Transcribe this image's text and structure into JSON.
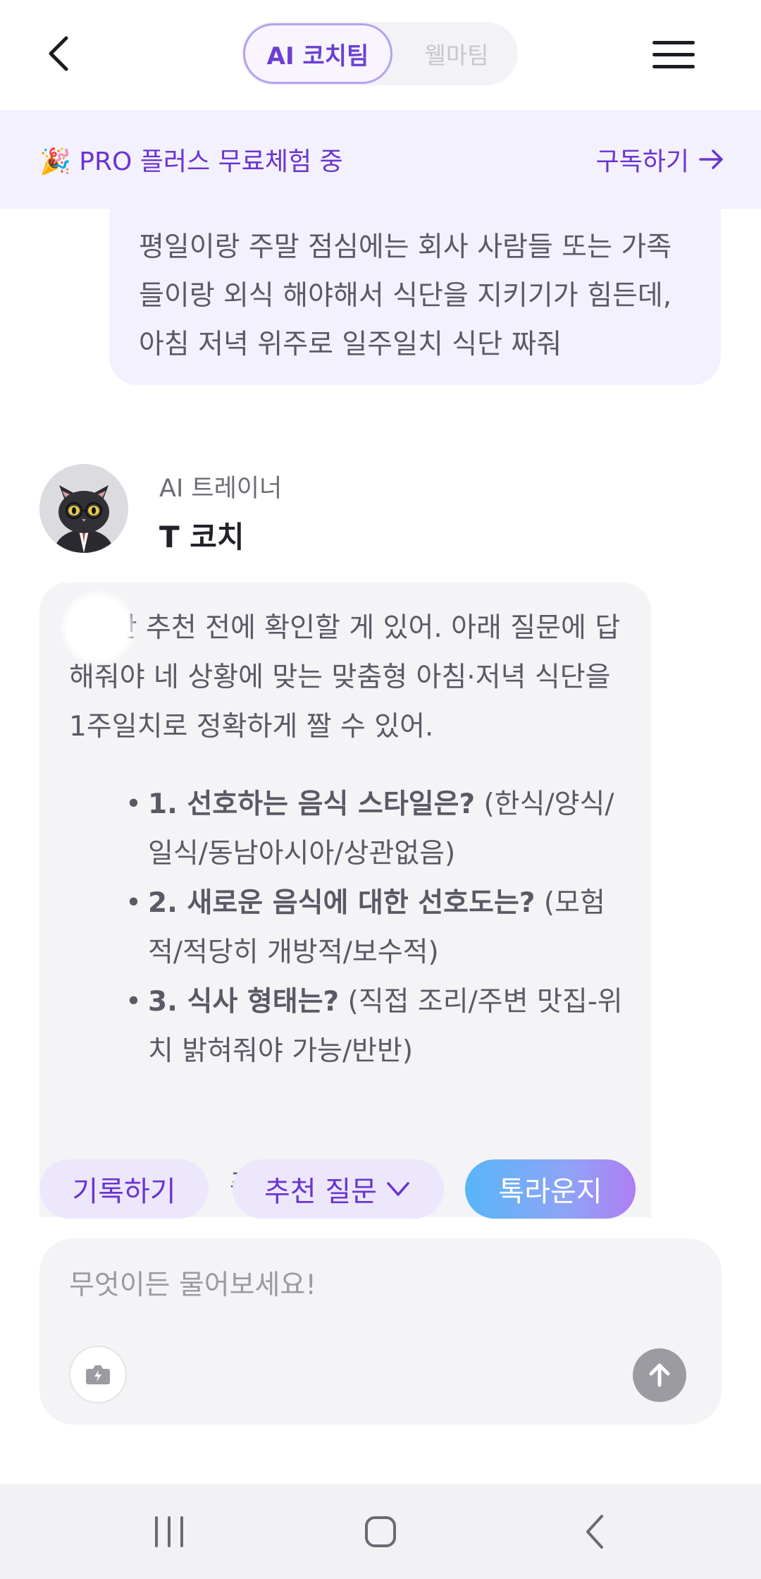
{
  "header": {
    "tabs": [
      {
        "label": "AI 코치팀",
        "active": true
      },
      {
        "label": "웰마팀",
        "active": false
      }
    ],
    "back_icon": "chevron-left-icon",
    "menu_icon": "hamburger-menu-icon"
  },
  "promo": {
    "emoji": "🎉",
    "text": "PRO 플러스 무료체험 중",
    "cta": "구독하기"
  },
  "user_message": "평일이랑 주말 점심에는 회사 사람들 또는 가족들이랑 외식 해야해서 식단을 지키기가 힘든데, 아침 저녁 위주로 일주일치 식단 짜줘",
  "coach": {
    "role": "AI 트레이너",
    "name": "T 코치"
  },
  "ai_message": {
    "intro": "     , 식단 추천 전에 확인할 게 있어. 아래 질문에 답해줘야 네 상황에 맞는 맞춤형 아침·저녁 식단을 1주일치로 정확하게 짤 수 있어.",
    "questions": [
      {
        "q": "1. 선호하는 음식 스타일은?",
        "opts": " (한식/양식/일식/동남아시아/상관없음)"
      },
      {
        "q": "2. 새로운 음식에 대한 선호도는?",
        "opts": " (모험적/적당히 개방적/보수적)"
      },
      {
        "q": "3. 식사 형태는?",
        "opts": " (직접 조리/주변 맛집-위치 밝혀줘야 가능/반반)"
      }
    ],
    "cut_fragment": "주"
  },
  "chips": {
    "record": "기록하기",
    "suggest": "추천 질문",
    "talk": "톡라운지"
  },
  "input": {
    "placeholder": "무엇이든 물어보세요!",
    "value": ""
  },
  "colors": {
    "accent": "#6a35d0",
    "promo_bg": "#f3f1fe",
    "bubble_bg": "#f4f4f7"
  }
}
